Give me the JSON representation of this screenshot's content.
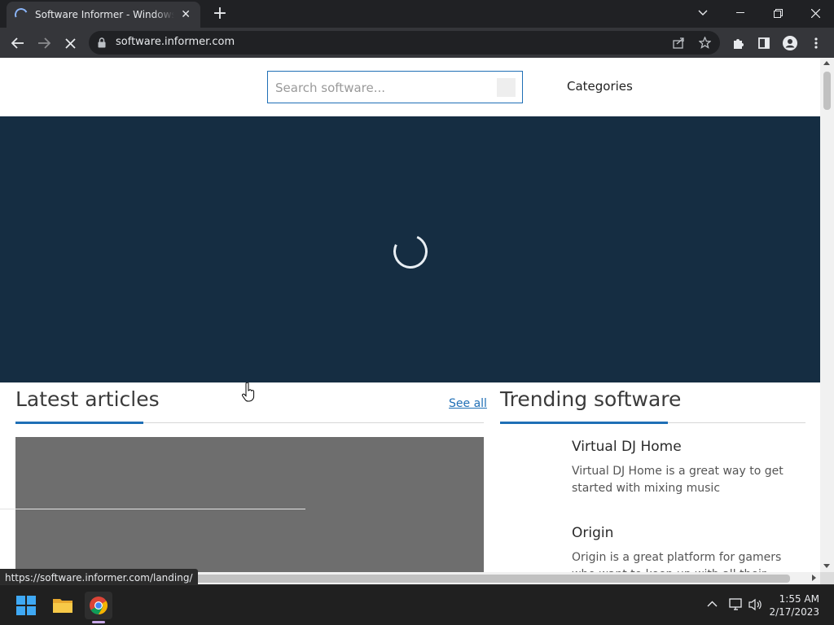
{
  "browser": {
    "tab": {
      "title": "Software Informer - Windows software",
      "close": "✕"
    },
    "new_tab": "+",
    "url": "software.informer.com"
  },
  "page": {
    "search": {
      "placeholder": "Search software..."
    },
    "categories_label": "Categories",
    "latest": {
      "heading": "Latest articles",
      "see_all": "See all"
    },
    "trending": {
      "heading": "Trending software",
      "items": [
        {
          "name": "Virtual DJ Home",
          "desc": "Virtual DJ Home is a great way to get started with mixing music"
        },
        {
          "name": "Origin",
          "desc": "Origin is a great platform for gamers who want to keep up with all their favorite games"
        }
      ]
    },
    "colors": {
      "accent": "#1f6fb6",
      "hero_bg": "#152d42"
    }
  },
  "status_url": "https://software.informer.com/landing/",
  "taskbar": {
    "time": "1:55 AM",
    "date": "2/17/2023"
  }
}
